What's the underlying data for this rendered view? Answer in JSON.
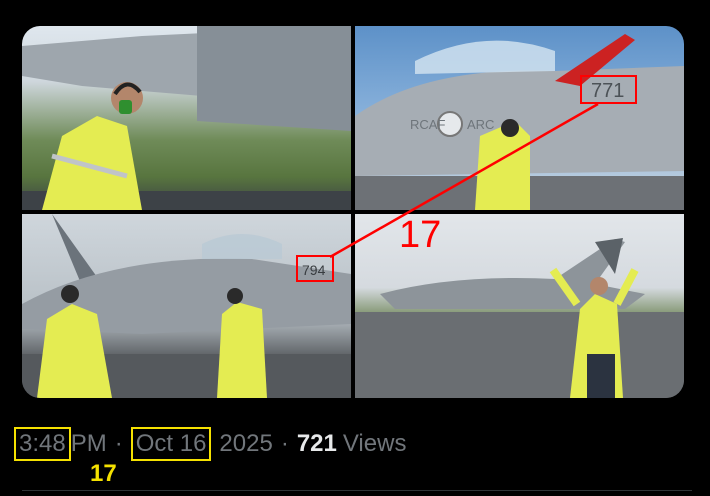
{
  "post": {
    "time": "3:48",
    "ampm": "PM",
    "separator": "·",
    "date": "Oct 16",
    "year": "2025",
    "views_count": "721",
    "views_label": "Views"
  },
  "images": [
    {
      "alt": "Ground crew member with headset beside jet wing"
    },
    {
      "alt": "RCAF CF-18 cockpit with tail number 771 during refuelling"
    },
    {
      "alt": "CF-18 jet 794 on tarmac with ground crew"
    },
    {
      "alt": "Marshaller signalling to taxiing CF-18"
    }
  ],
  "aircraft": {
    "number_top": "771",
    "number_bottom": "794",
    "marking_rcaf": "RCAF",
    "marking_arc": "ARC"
  },
  "annotations": {
    "red_number": "17",
    "yellow_number": "17"
  },
  "colors": {
    "annotation_red": "#ff0000",
    "annotation_yellow": "#f5e100",
    "text_secondary": "#71767b",
    "text_primary": "#e7e9ea"
  }
}
